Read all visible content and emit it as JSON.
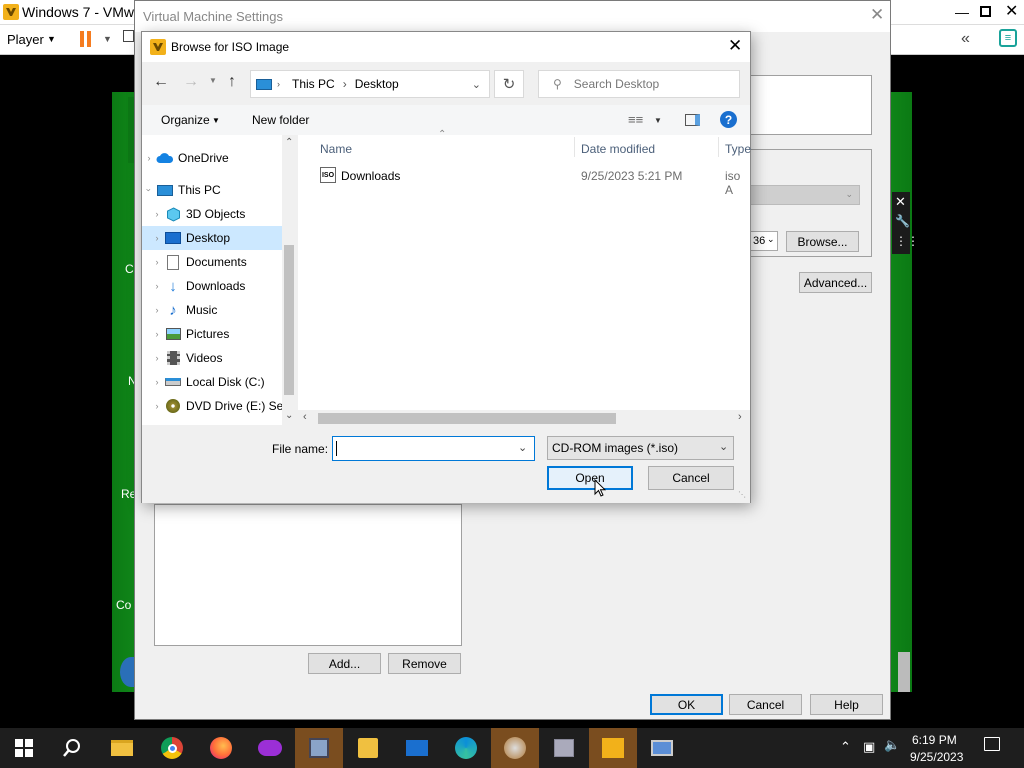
{
  "vmware": {
    "title": "Windows 7 - VMware",
    "player_menu": "Player",
    "side_labels": [
      "C",
      "N",
      "Re",
      "Co"
    ]
  },
  "vm_settings": {
    "title": "Virtual Machine Settings",
    "browse_label": "Browse...",
    "advanced_label": "Advanced...",
    "combo_fragment": "36",
    "add_label": "Add...",
    "remove_label": "Remove",
    "ok_label": "OK",
    "cancel_label": "Cancel",
    "help_label": "Help"
  },
  "dialog": {
    "title": "Browse for ISO Image",
    "breadcrumb": [
      "This PC",
      "Desktop"
    ],
    "search_placeholder": "Search Desktop",
    "organize_label": "Organize",
    "new_folder_label": "New folder",
    "nav_items": [
      {
        "label": "OneDrive",
        "icon": "onedrive-icon"
      },
      {
        "label": "This PC",
        "icon": "computer-icon"
      },
      {
        "label": "3D Objects",
        "icon": "3d-objects-icon"
      },
      {
        "label": "Desktop",
        "icon": "desktop-icon",
        "selected": true
      },
      {
        "label": "Documents",
        "icon": "documents-icon"
      },
      {
        "label": "Downloads",
        "icon": "downloads-icon"
      },
      {
        "label": "Music",
        "icon": "music-icon"
      },
      {
        "label": "Pictures",
        "icon": "pictures-icon"
      },
      {
        "label": "Videos",
        "icon": "videos-icon"
      },
      {
        "label": "Local Disk (C:)",
        "icon": "local-disk-icon"
      },
      {
        "label": "DVD Drive (E:) Se",
        "icon": "dvd-drive-icon"
      }
    ],
    "columns": {
      "name": "Name",
      "date": "Date modified",
      "type": "Type"
    },
    "files": [
      {
        "name": "Downloads",
        "date": "9/25/2023 5:21 PM",
        "type": "iso A",
        "icon": "iso-file-icon"
      }
    ],
    "file_name_label": "File name:",
    "file_name_value": "",
    "filter_value": "CD-ROM images (*.iso)",
    "open_label": "Open",
    "cancel_label": "Cancel"
  },
  "taskbar": {
    "time": "6:19 PM",
    "date": "9/25/2023"
  },
  "colors": {
    "accent": "#0078d7",
    "guest_green": "#2ec835",
    "selection": "#cce8ff"
  }
}
